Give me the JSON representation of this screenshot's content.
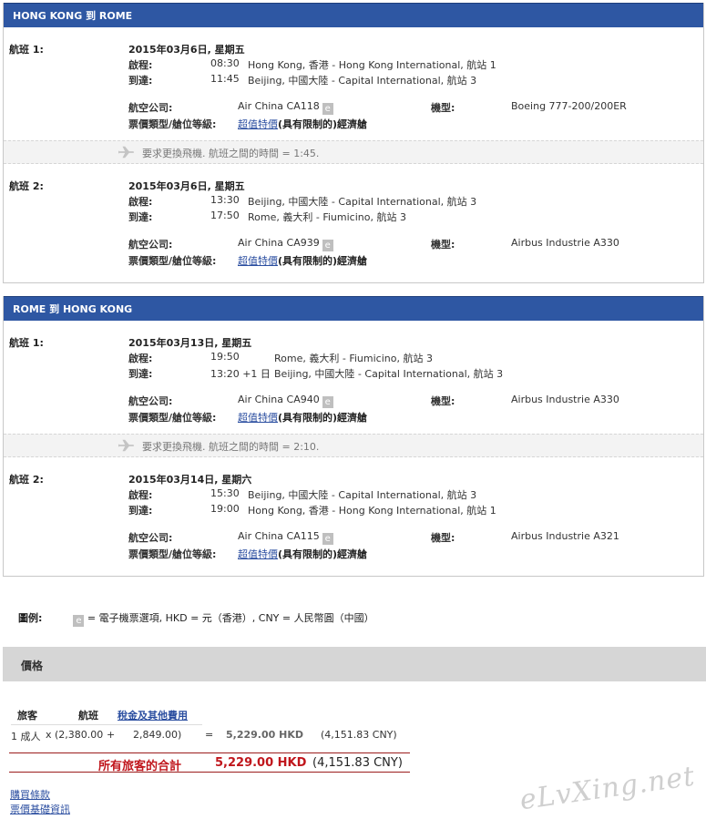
{
  "trips": [
    {
      "title": "HONG KONG 到 ROME",
      "flights": [
        {
          "label": "航班 1:",
          "date": "2015年03月6日, 星期五",
          "depart_label": "啟程:",
          "depart_time": "08:30",
          "depart_place": "Hong Kong, 香港 - Hong Kong International, 航站 1",
          "arrive_label": "到達:",
          "arrive_time": "11:45",
          "arrive_place": "Beijing, 中國大陸 - Capital International, 航站 3",
          "airline_label": "航空公司:",
          "airline": "Air China CA118",
          "eticket": "e",
          "aircraft_label": "機型:",
          "aircraft": "Boeing 777-200/200ER",
          "fare_label": "票價類型/艙位等級:",
          "fare_link": "超值特價",
          "fare_rest": "(具有限制的)經濟艙"
        },
        {
          "label": "航班 2:",
          "date": "2015年03月6日, 星期五",
          "depart_label": "啟程:",
          "depart_time": "13:30",
          "depart_place": "Beijing, 中國大陸 - Capital International, 航站 3",
          "arrive_label": "到達:",
          "arrive_time": "17:50",
          "arrive_place": "Rome, 義大利 - Fiumicino, 航站 3",
          "airline_label": "航空公司:",
          "airline": "Air China CA939",
          "eticket": "e",
          "aircraft_label": "機型:",
          "aircraft": "Airbus Industrie A330",
          "fare_label": "票價類型/艙位等級:",
          "fare_link": "超值特價",
          "fare_rest": "(具有限制的)經濟艙"
        }
      ],
      "connection": "要求更換飛機. 航班之間的時間 = 1:45."
    },
    {
      "title": "ROME 到 HONG KONG",
      "flights": [
        {
          "label": "航班 1:",
          "date": "2015年03月13日, 星期五",
          "depart_label": "啟程:",
          "depart_time": "19:50",
          "depart_place": "Rome, 義大利 - Fiumicino, 航站 3",
          "arrive_label": "到達:",
          "arrive_time": "13:20 +1 日",
          "arrive_place": "Beijing, 中國大陸 - Capital International, 航站 3",
          "airline_label": "航空公司:",
          "airline": "Air China CA940",
          "eticket": "e",
          "aircraft_label": "機型:",
          "aircraft": "Airbus Industrie A330",
          "fare_label": "票價類型/艙位等級:",
          "fare_link": "超值特價",
          "fare_rest": "(具有限制的)經濟艙"
        },
        {
          "label": "航班 2:",
          "date": "2015年03月14日, 星期六",
          "depart_label": "啟程:",
          "depart_time": "15:30",
          "depart_place": "Beijing, 中國大陸 - Capital International, 航站 3",
          "arrive_label": "到達:",
          "arrive_time": "19:00",
          "arrive_place": "Hong Kong, 香港 - Hong Kong International, 航站 1",
          "airline_label": "航空公司:",
          "airline": "Air China CA115",
          "eticket": "e",
          "aircraft_label": "機型:",
          "aircraft": "Airbus Industrie A321",
          "fare_label": "票價類型/艙位等級:",
          "fare_link": "超值特價",
          "fare_rest": "(具有限制的)經濟艙"
        }
      ],
      "connection": "要求更換飛機. 航班之間的時間 = 2:10."
    }
  ],
  "legend": {
    "title": "圖例:",
    "eticket": "e",
    "text": "= 電子機票選項,  HKD = 元（香港）,  CNY = 人民幣圓（中國）"
  },
  "price": {
    "title": "價格",
    "col_passenger": "旅客",
    "col_flight": "航班",
    "col_taxes": "稅金及其他費用",
    "row": {
      "passenger": "1 成人",
      "times": "x",
      "flight_amount": "(2,380.00",
      "plus": "+",
      "tax_amount": "2,849.00)",
      "equals": "=",
      "total_hkd": "5,229.00 HKD",
      "total_cny": "(4,151.83 CNY)"
    },
    "grand_label": "所有旅客的合計",
    "grand_hkd": "5,229.00 HKD",
    "grand_cny": "(4,151.83 CNY)"
  },
  "footer_links": [
    "購買條款",
    "票價基礎資訊"
  ],
  "watermark": "eLvXing.net",
  "colors": {
    "header": "#2e57a3",
    "link": "#2b4ea0",
    "total": "#c0161c"
  }
}
